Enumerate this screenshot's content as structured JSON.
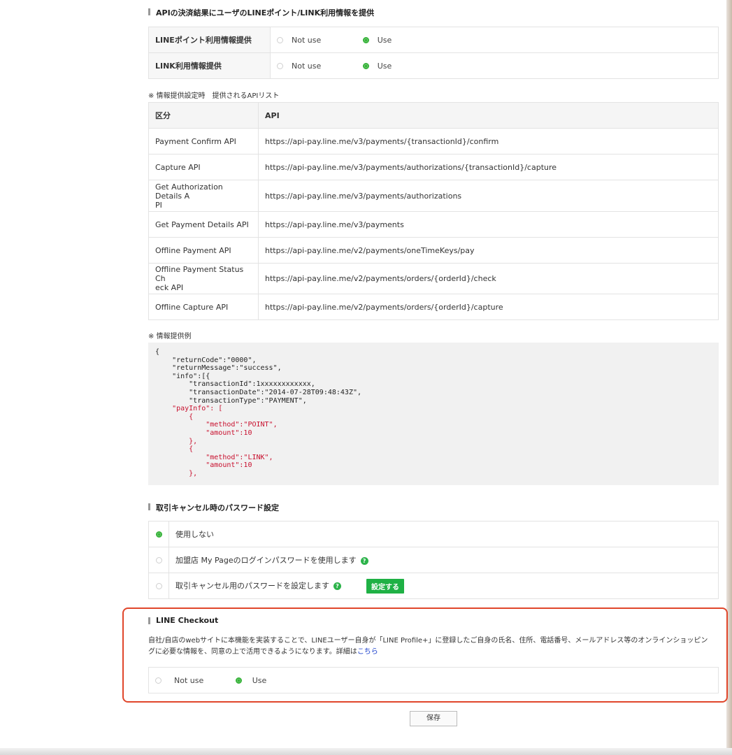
{
  "section1": {
    "title": "APIの決済結果にユーザのLINEポイント/LINK利用情報を提供",
    "rows": [
      {
        "label": "LINEポイント利用情報提供",
        "opt1": "Not use",
        "opt2": "Use",
        "selected": "Use"
      },
      {
        "label": "LINK利用情報提供",
        "opt1": "Not use",
        "opt2": "Use",
        "selected": "Use"
      }
    ]
  },
  "api_list": {
    "note": "※ 情報提供設定時　提供されるAPIリスト",
    "headers": [
      "区分",
      "API"
    ],
    "rows": [
      {
        "name": "Payment Confirm API",
        "url": "https://api-pay.line.me/v3/payments/{transactionId}/confirm"
      },
      {
        "name": "Capture API",
        "url": "https://api-pay.line.me/v3/payments/authorizations/{transactionId}/capture"
      },
      {
        "name": "Get Authorization Details A\nPI",
        "url": "https://api-pay.line.me/v3/payments/authorizations"
      },
      {
        "name": "Get Payment Details API",
        "url": "https://api-pay.line.me/v3/payments"
      },
      {
        "name": "Offline Payment API",
        "url": "https://api-pay.line.me/v2/payments/oneTimeKeys/pay"
      },
      {
        "name": "Offline Payment Status Ch\neck API",
        "url": "https://api-pay.line.me/v2/payments/orders/{orderId}/check"
      },
      {
        "name": "Offline Capture API",
        "url": "https://api-pay.line.me/v2/payments/orders/{orderId}/capture"
      }
    ]
  },
  "example": {
    "note": "※ 情報提供例",
    "code_lines": [
      "{",
      "    \"returnCode\":\"0000\",",
      "    \"returnMessage\":\"success\",",
      "    \"info\":[{",
      "        \"transactionId\":1xxxxxxxxxxxx,",
      "        \"transactionDate\":\"2014-07-28T09:48:43Z\",",
      "        \"transactionType\":\"PAYMENT\","
    ],
    "code_red_lines": [
      "    \"payInfo\": [",
      "        {",
      "            \"method\":\"POINT\",",
      "            \"amount\":10",
      "        },",
      "        {",
      "            \"method\":\"LINK\",",
      "            \"amount\":10",
      "        },"
    ]
  },
  "cancel_password": {
    "title": "取引キャンセル時のパスワード設定",
    "options": [
      {
        "label": "使用しない",
        "selected": true
      },
      {
        "label": "加盟店 My Pageのログインパスワードを使用します",
        "selected": false
      },
      {
        "label": "取引キャンセル用のパスワードを設定します",
        "selected": false
      }
    ],
    "help_glyph": "?",
    "set_button": "設定する"
  },
  "checkout": {
    "title": "LINE Checkout",
    "desc_line1": "自社/自店のwebサイトに本機能を実装することで、LINEユーザー自身が「LINE Profile+」に登録したご自身の氏名、住所、電話番号、メールアドレス等のオンラインショッピン",
    "desc_line2": "グに必要な情報を、同意の上で活用できるようになります。詳細は",
    "desc_link": "こちら",
    "opt1": "Not use",
    "opt2": "Use",
    "selected": "Use"
  },
  "save_button": "保存",
  "colors": {
    "accent_green": "#37b33a",
    "button_green": "#1fb145",
    "highlight_red": "#e0462b",
    "link_blue": "#1a3fcc",
    "code_red": "#c8102e"
  }
}
